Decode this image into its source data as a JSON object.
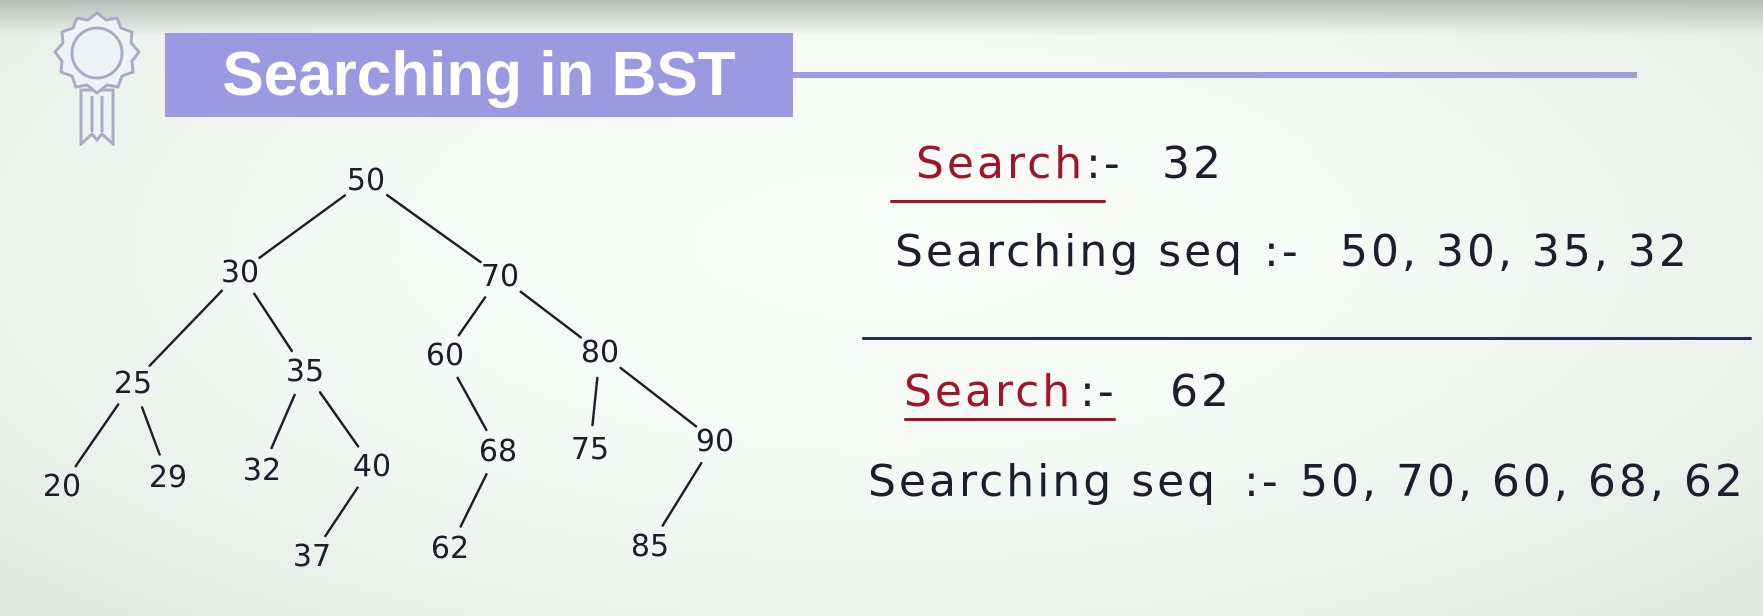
{
  "title": "Searching in BST",
  "icon": "award-ribbon-icon",
  "colors": {
    "title_bg": "#9a9ae0",
    "title_text": "#ffffff",
    "accent_red": "#a01628",
    "ink": "#1d1d2b",
    "divider": "#1f2a6a"
  },
  "tree": {
    "nodes": [
      {
        "id": "n50",
        "label": "50"
      },
      {
        "id": "n30",
        "label": "30"
      },
      {
        "id": "n70",
        "label": "70"
      },
      {
        "id": "n25",
        "label": "25"
      },
      {
        "id": "n35",
        "label": "35"
      },
      {
        "id": "n60",
        "label": "60"
      },
      {
        "id": "n80",
        "label": "80"
      },
      {
        "id": "n20",
        "label": "20"
      },
      {
        "id": "n29",
        "label": "29"
      },
      {
        "id": "n32",
        "label": "32"
      },
      {
        "id": "n40",
        "label": "40"
      },
      {
        "id": "n68",
        "label": "68"
      },
      {
        "id": "n75",
        "label": "75"
      },
      {
        "id": "n90",
        "label": "90"
      },
      {
        "id": "n37",
        "label": "37"
      },
      {
        "id": "n62",
        "label": "62"
      },
      {
        "id": "n85",
        "label": "85"
      }
    ],
    "edges": [
      [
        "n50",
        "n30"
      ],
      [
        "n50",
        "n70"
      ],
      [
        "n30",
        "n25"
      ],
      [
        "n30",
        "n35"
      ],
      [
        "n70",
        "n60"
      ],
      [
        "n70",
        "n80"
      ],
      [
        "n25",
        "n20"
      ],
      [
        "n25",
        "n29"
      ],
      [
        "n35",
        "n32"
      ],
      [
        "n35",
        "n40"
      ],
      [
        "n60",
        "n68"
      ],
      [
        "n80",
        "n75"
      ],
      [
        "n80",
        "n90"
      ],
      [
        "n40",
        "n37"
      ],
      [
        "n68",
        "n62"
      ],
      [
        "n90",
        "n85"
      ]
    ]
  },
  "searches": [
    {
      "label": "Search",
      "separator": ":-",
      "value": "32",
      "sequence_label": "Searching seq",
      "sequence_separator": ":-",
      "sequence": "50, 30, 35, 32"
    },
    {
      "label": "Search",
      "separator": ":-",
      "value": "62",
      "sequence_label": "Searching seq",
      "sequence_separator": ":-",
      "sequence": "50, 70, 60, 68, 62"
    }
  ]
}
